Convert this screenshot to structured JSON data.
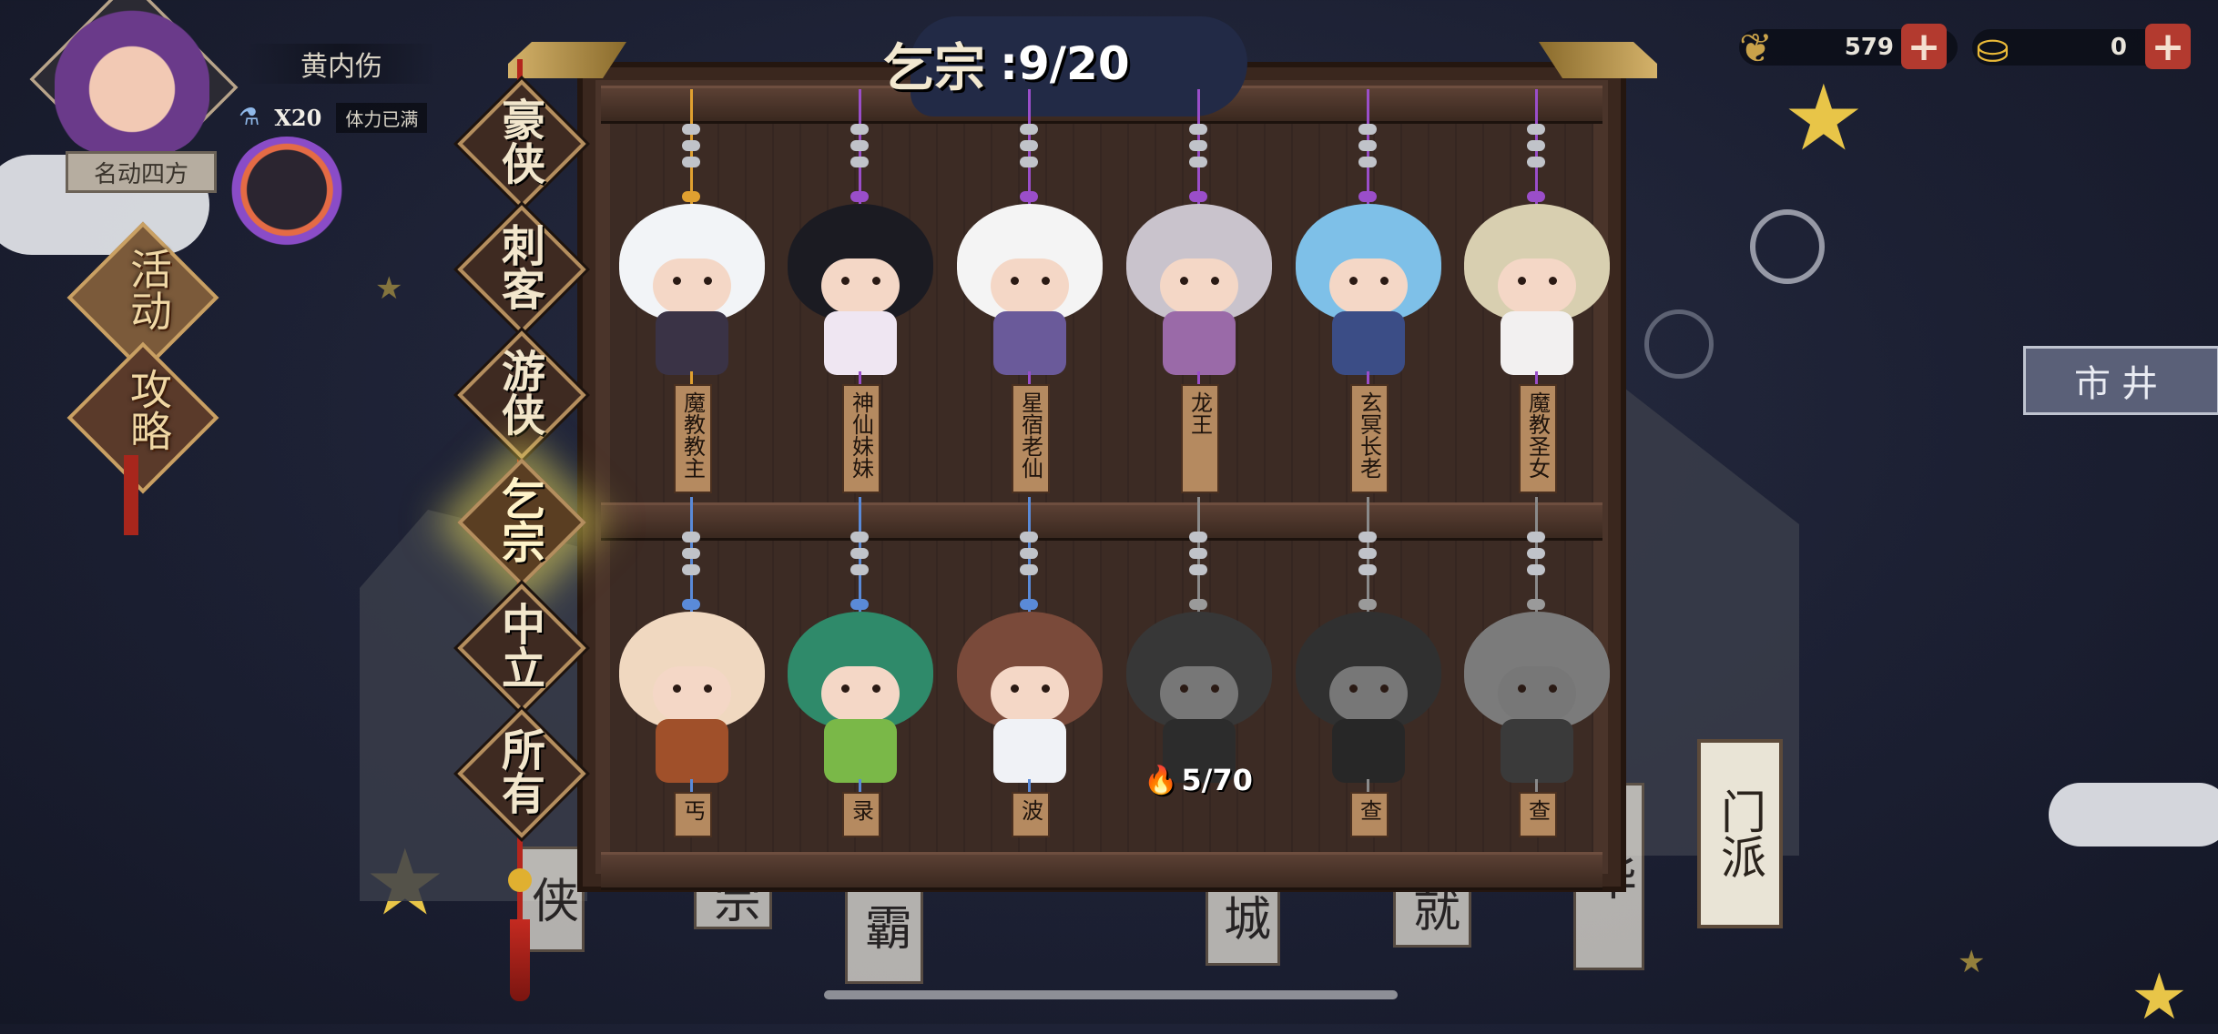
{
  "player": {
    "name": "黄内伤",
    "stamina_count": "X20",
    "stamina_status": "体力已满",
    "title": "名动四方"
  },
  "side_menu": {
    "event_label": "活动",
    "guide_label": "攻略"
  },
  "currency": {
    "leaf_amount": "579",
    "gold_amount": "0",
    "plus_symbol": "+"
  },
  "collection": {
    "category_name": "乞宗",
    "count": ":9/20"
  },
  "categories": [
    {
      "label": "豪侠",
      "active": false
    },
    {
      "label": "刺客",
      "active": false
    },
    {
      "label": "游侠",
      "active": false
    },
    {
      "label": "乞宗",
      "active": true
    },
    {
      "label": "中立",
      "active": false
    },
    {
      "label": "所有",
      "active": false
    }
  ],
  "characters_top": [
    {
      "name": "魔教教主",
      "string_color": "#e0a030",
      "head_color": "#f2f4f7",
      "body_color": "#3a3346"
    },
    {
      "name": "神仙妹妹",
      "string_color": "#9a4ec9",
      "head_color": "#1b1b22",
      "body_color": "#efe6f2"
    },
    {
      "name": "星宿老仙",
      "string_color": "#9a4ec9",
      "head_color": "#f4f4f4",
      "body_color": "#6a5a9a"
    },
    {
      "name": "龙王",
      "string_color": "#9a4ec9",
      "head_color": "#c9c3cc",
      "body_color": "#9a6aa8"
    },
    {
      "name": "玄冥长老",
      "string_color": "#9a4ec9",
      "head_color": "#7ec0e8",
      "body_color": "#3b4d86"
    },
    {
      "name": "魔教圣女",
      "string_color": "#9a4ec9",
      "head_color": "#d8cfb0",
      "body_color": "#f2f0f0"
    }
  ],
  "characters_bottom": [
    {
      "name": "丐",
      "string_color": "#5a8ad8",
      "head_color": "#f0d8c0",
      "body_color": "#a0502a",
      "locked": false
    },
    {
      "name": "录",
      "string_color": "#5a8ad8",
      "head_color": "#2f8a6a",
      "body_color": "#7ab848",
      "locked": false
    },
    {
      "name": "波",
      "string_color": "#5a8ad8",
      "head_color": "#7a4a3a",
      "body_color": "#f0f2f6",
      "locked": false
    },
    {
      "name": "",
      "string_color": "#8a8a8a",
      "head_color": "#555555",
      "body_color": "#444444",
      "locked": true,
      "progress": "5/70"
    },
    {
      "name": "查",
      "string_color": "#8a8a8a",
      "head_color": "#4a4a4a",
      "body_color": "#3c3c3c",
      "locked": true
    },
    {
      "name": "查",
      "string_color": "#8a8a8a",
      "head_color": "#bdbdbd",
      "body_color": "#5a5a5a",
      "locked": true
    }
  ],
  "right_panel": {
    "market_label": "市井",
    "sect_label": "门派"
  },
  "background_placards": [
    "侠",
    "宗",
    "霸",
    "城",
    "就",
    "华"
  ]
}
